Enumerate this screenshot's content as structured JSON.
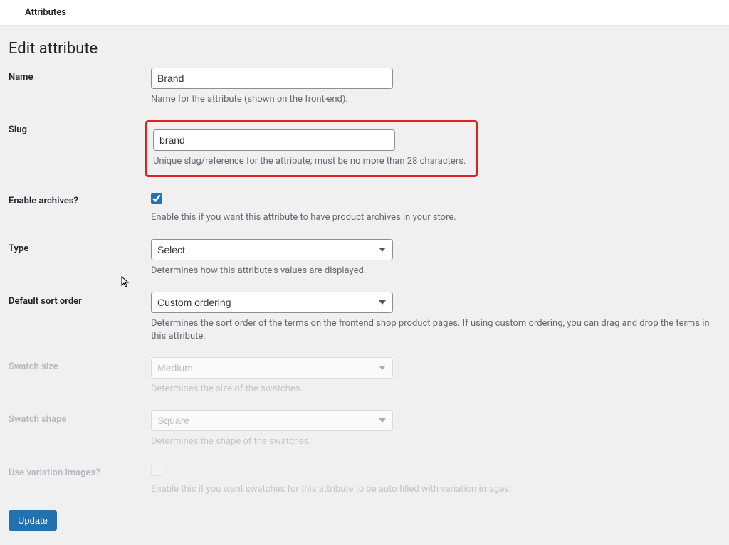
{
  "topbar": {
    "title": "Attributes"
  },
  "page": {
    "title": "Edit attribute"
  },
  "fields": {
    "name": {
      "label": "Name",
      "value": "Brand",
      "help": "Name for the attribute (shown on the front-end)."
    },
    "slug": {
      "label": "Slug",
      "value": "brand",
      "help": "Unique slug/reference for the attribute; must be no more than 28 characters."
    },
    "archives": {
      "label": "Enable archives?",
      "checked": true,
      "help": "Enable this if you want this attribute to have product archives in your store."
    },
    "type": {
      "label": "Type",
      "value": "Select",
      "help": "Determines how this attribute's values are displayed."
    },
    "sort": {
      "label": "Default sort order",
      "value": "Custom ordering",
      "help": "Determines the sort order of the terms on the frontend shop product pages. If using custom ordering, you can drag and drop the terms in this attribute."
    },
    "swatch_size": {
      "label": "Swatch size",
      "value": "Medium",
      "help": "Determines the size of the swatches."
    },
    "swatch_shape": {
      "label": "Swatch shape",
      "value": "Square",
      "help": "Determines the shape of the swatches."
    },
    "variation_images": {
      "label": "Use variation images?",
      "checked": false,
      "help": "Enable this if you want swatches for this attribute to be auto filled with variation images."
    }
  },
  "buttons": {
    "update": "Update"
  }
}
